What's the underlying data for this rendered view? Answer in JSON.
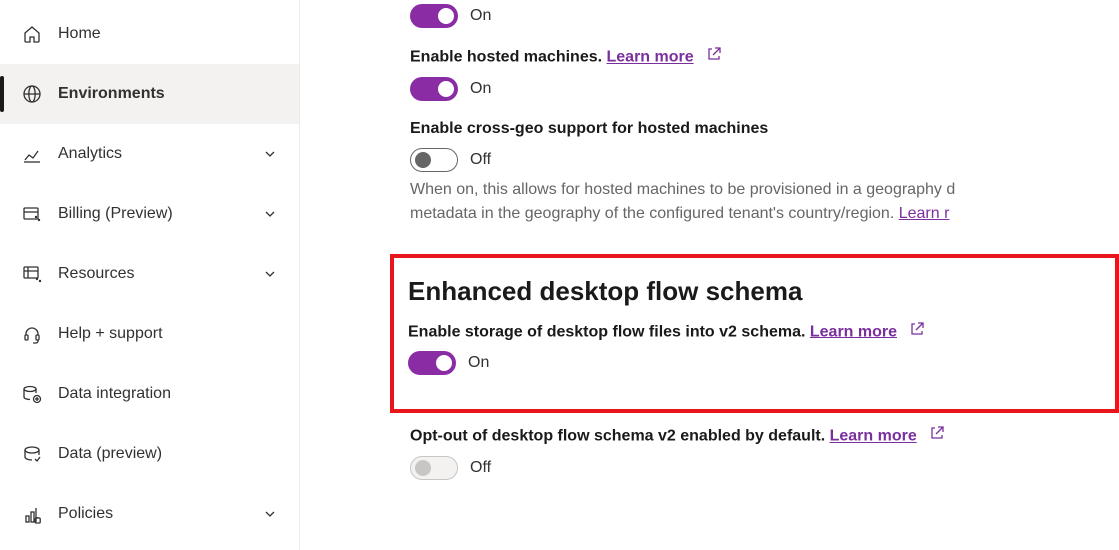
{
  "sidebar": {
    "items": [
      {
        "label": "Home"
      },
      {
        "label": "Environments"
      },
      {
        "label": "Analytics"
      },
      {
        "label": "Billing (Preview)"
      },
      {
        "label": "Resources"
      },
      {
        "label": "Help + support"
      },
      {
        "label": "Data integration"
      },
      {
        "label": "Data (preview)"
      },
      {
        "label": "Policies"
      }
    ]
  },
  "main": {
    "toggle_on_state": "On",
    "toggle_off_state": "Off",
    "setting1": {
      "state": "On"
    },
    "setting2": {
      "label_prefix": "Enable hosted machines. ",
      "learn_more": "Learn more",
      "state": "On"
    },
    "setting3": {
      "label": "Enable cross-geo support for hosted machines",
      "state": "Off",
      "description_prefix": "When on, this allows for hosted machines to be provisioned in a geography d",
      "description_suffix": "metadata in the geography of the configured tenant's country/region. ",
      "learn_more_trunc": "Learn r"
    },
    "section": {
      "title": "Enhanced desktop flow schema",
      "setting4": {
        "label_prefix": "Enable storage of desktop flow files into v2 schema. ",
        "learn_more": "Learn more",
        "state": "On"
      },
      "setting5": {
        "label_prefix": "Opt-out of desktop flow schema v2 enabled by default. ",
        "learn_more": "Learn more",
        "state": "Off"
      }
    }
  }
}
